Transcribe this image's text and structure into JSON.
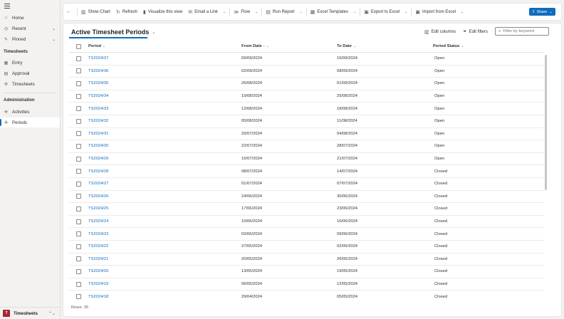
{
  "sidebar": {
    "top_items": [
      {
        "label": "Home",
        "icon": "home-icon",
        "glyph": "⌂"
      },
      {
        "label": "Recent",
        "icon": "clock-icon",
        "glyph": "◷",
        "chevron": "⌄"
      },
      {
        "label": "Pinned",
        "icon": "pin-icon",
        "glyph": "✎",
        "chevron": "⌄"
      }
    ],
    "sections": [
      {
        "title": "Timesheets",
        "items": [
          {
            "label": "Entry",
            "icon": "calendar-icon",
            "glyph": "▦"
          },
          {
            "label": "Approval",
            "icon": "document-icon",
            "glyph": "▤"
          },
          {
            "label": "Timesheets",
            "icon": "gear-icon",
            "glyph": "✣"
          }
        ]
      },
      {
        "title": "Administration",
        "items": [
          {
            "label": "Activities",
            "icon": "gear-icon",
            "glyph": "✣"
          },
          {
            "label": "Periods",
            "icon": "gear-icon",
            "glyph": "✣",
            "selected": true
          }
        ]
      }
    ],
    "area": {
      "tile": "T",
      "label": "Timesheets",
      "chevron": "⌃⌄"
    }
  },
  "commands": [
    {
      "label": "",
      "icon": "back-arrow-icon",
      "glyph": "←"
    },
    {
      "label": "Show Chart",
      "icon": "chart-icon",
      "glyph": "▥"
    },
    {
      "label": "Refresh",
      "icon": "refresh-icon",
      "glyph": "↻"
    },
    {
      "label": "Visualize this view",
      "icon": "powerbi-icon",
      "glyph": "▮"
    },
    {
      "label": "Email a Link",
      "icon": "email-icon",
      "glyph": "✉",
      "dropdown": "⌄"
    },
    {
      "label": "Flow",
      "icon": "flow-icon",
      "glyph": "≫",
      "dropdown": "⌄"
    },
    {
      "label": "Run Report",
      "icon": "report-icon",
      "glyph": "▤",
      "dropdown": "⌄"
    },
    {
      "label": "Excel Templates",
      "icon": "excel-template-icon",
      "glyph": "▦",
      "dropdown": "⌄"
    },
    {
      "label": "Export to Excel",
      "icon": "excel-icon",
      "glyph": "▣",
      "dropdown": "⌄"
    },
    {
      "label": "Import from Excel",
      "icon": "import-excel-icon",
      "glyph": "▣",
      "dropdown": "⌄"
    }
  ],
  "share": {
    "label": "Share",
    "dropdown": "⌄",
    "icon": "share-icon",
    "glyph": "⇪"
  },
  "view": {
    "title": "Active Timesheet Periods",
    "dropdown": "⌄",
    "edit_columns": "Edit columns",
    "edit_filters": "Edit filters",
    "filter_placeholder": "Filter by keyword"
  },
  "table": {
    "columns": [
      {
        "label": "Period",
        "sort": "⌄"
      },
      {
        "label": "From Date",
        "sort": "↓ ⌄"
      },
      {
        "label": "To Date",
        "sort": "⌄"
      },
      {
        "label": "Period Status",
        "sort": "⌄"
      }
    ],
    "rows": [
      [
        "TS2024/37",
        "09/09/2024",
        "15/09/2024",
        "Open"
      ],
      [
        "TS2024/36",
        "02/09/2024",
        "08/09/2024",
        "Open"
      ],
      [
        "TS2024/35",
        "26/08/2024",
        "01/09/2024",
        "Open"
      ],
      [
        "TS2024/34",
        "19/08/2024",
        "25/08/2024",
        "Open"
      ],
      [
        "TS2024/33",
        "12/08/2024",
        "18/08/2024",
        "Open"
      ],
      [
        "TS2024/32",
        "05/08/2024",
        "11/08/2024",
        "Open"
      ],
      [
        "TS2024/31",
        "29/07/2024",
        "04/08/2024",
        "Open"
      ],
      [
        "TS2024/30",
        "22/07/2024",
        "28/07/2024",
        "Open"
      ],
      [
        "TS2024/29",
        "15/07/2024",
        "21/07/2024",
        "Open"
      ],
      [
        "TS2024/28",
        "08/07/2024",
        "14/07/2024",
        "Closed"
      ],
      [
        "TS2024/27",
        "01/07/2024",
        "07/07/2024",
        "Closed"
      ],
      [
        "TS2024/26",
        "24/06/2024",
        "30/06/2024",
        "Closed"
      ],
      [
        "TS2024/25",
        "17/06/2024",
        "23/06/2024",
        "Closed"
      ],
      [
        "TS2024/24",
        "10/06/2024",
        "16/06/2024",
        "Closed"
      ],
      [
        "TS2024/23",
        "03/06/2024",
        "09/06/2024",
        "Closed"
      ],
      [
        "TS2024/22",
        "27/05/2024",
        "02/06/2024",
        "Closed"
      ],
      [
        "TS2024/21",
        "20/05/2024",
        "26/05/2024",
        "Closed"
      ],
      [
        "TS2024/20",
        "13/05/2024",
        "19/05/2024",
        "Closed"
      ],
      [
        "TS2024/19",
        "06/05/2024",
        "12/05/2024",
        "Closed"
      ],
      [
        "TS2024/18",
        "29/04/2024",
        "05/05/2024",
        "Closed"
      ]
    ],
    "row_count": "Rows: 35"
  },
  "colors": {
    "accent": "#0f6cbd",
    "area_tile": "#a4262c"
  }
}
